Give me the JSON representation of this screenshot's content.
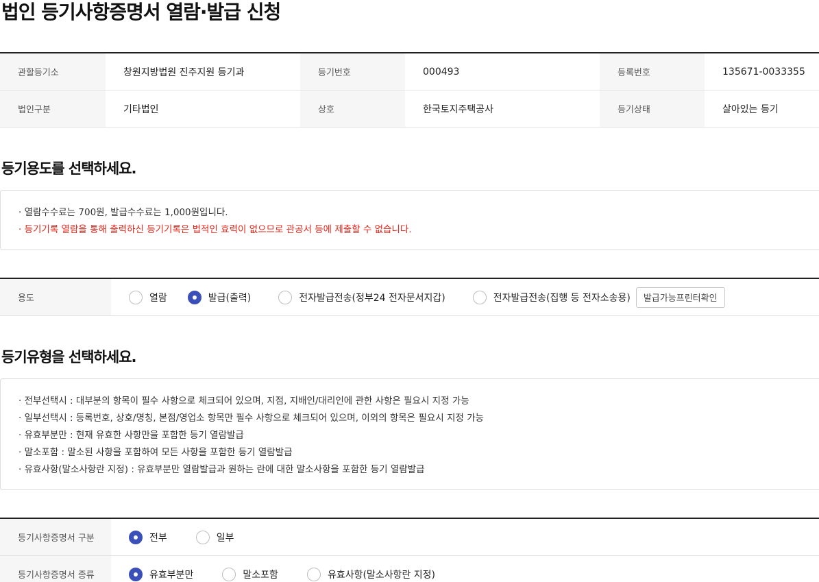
{
  "page_title": "법인 등기사항증명서 열람·발급 신청",
  "info": {
    "rows": [
      [
        {
          "label": "관할등기소",
          "value": "창원지방법원 진주지원 등기과"
        },
        {
          "label": "등기번호",
          "value": "000493"
        },
        {
          "label": "등록번호",
          "value": "135671-0033355"
        }
      ],
      [
        {
          "label": "법인구분",
          "value": "기타법인"
        },
        {
          "label": "상호",
          "value": "한국토지주택공사"
        },
        {
          "label": "등기상태",
          "value": "살아있는 등기"
        }
      ]
    ]
  },
  "purpose_section": {
    "title": "등기용도를 선택하세요.",
    "notices": [
      "· 열람수수료는 700원, 발급수수료는 1,000원입니다.",
      "· 등기기록 열람을 통해 출력하신 등기기록은 법적인 효력이 없으므로 관공서 등에 제출할 수 없습니다."
    ],
    "row_label": "용도",
    "options": [
      {
        "label": "열람",
        "checked": false
      },
      {
        "label": "발급(출력)",
        "checked": true
      },
      {
        "label": "전자발급전송(정부24 전자문서지갑)",
        "checked": false
      },
      {
        "label": "전자발급전송(집행 등 전자소송용)",
        "checked": false
      }
    ],
    "printer_button": "발급가능프린터확인"
  },
  "type_section": {
    "title": "등기유형을 선택하세요.",
    "notices": [
      "· 전부선택시 : 대부분의 항목이 필수 사항으로 체크되어 있으며, 지점, 지배인/대리인에 관한 사항은 필요시 지정 가능",
      "· 일부선택시 : 등록번호, 상호/명칭, 본점/영업소 항목만 필수 사항으로 체크되어 있으며, 이외의 항목은 필요시 지정 가능",
      "· 유효부분만 : 현재 유효한 사항만을 포함한 등기 열람발급",
      "· 말소포함 : 말소된 사항을 포함하여 모든 사항을 포함한 등기 열람발급",
      "· 유효사항(말소사항란 지정) : 유효부분만 열람발급과 원하는 란에 대한 말소사항을 포함한 등기 열람발급"
    ],
    "scope_label": "등기사항증명서 구분",
    "scope_options": [
      {
        "label": "전부",
        "checked": true
      },
      {
        "label": "일부",
        "checked": false
      }
    ],
    "kind_label": "등기사항증명서 종류",
    "kind_options": [
      {
        "label": "유효부분만",
        "checked": true
      },
      {
        "label": "말소포함",
        "checked": false
      },
      {
        "label": "유효사항(말소사항란 지정)",
        "checked": false
      }
    ]
  }
}
